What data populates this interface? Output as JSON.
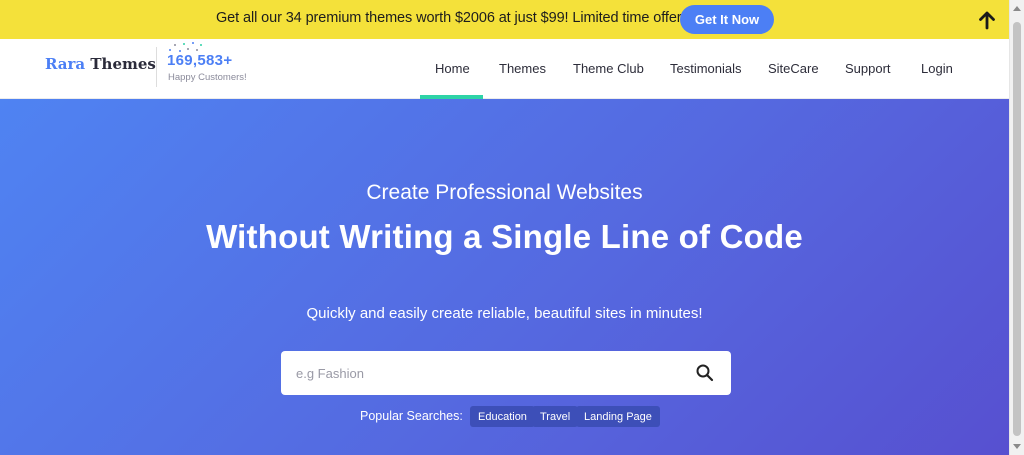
{
  "promo": {
    "text": "Get all our 34 premium themes worth $2006 at just $99! Limited time offer.",
    "button_label": "Get It Now",
    "colors": {
      "background": "#f4e13a",
      "button": "#4c7ff5"
    }
  },
  "header": {
    "logo_part1": "Rara",
    "logo_part2": "Themes",
    "customer_count": "169,583+",
    "customer_label": "Happy Customers!",
    "nav": [
      {
        "label": "Home",
        "active": true
      },
      {
        "label": "Themes"
      },
      {
        "label": "Theme Club"
      },
      {
        "label": "Testimonials"
      },
      {
        "label": "SiteCare"
      },
      {
        "label": "Support"
      },
      {
        "label": "Login"
      }
    ],
    "colors": {
      "accent": "#4c7ff5",
      "active_underline": "#2ed3a7"
    }
  },
  "hero": {
    "subtitle": "Create Professional Websites",
    "title": "Without Writing a Single Line of Code",
    "description": "Quickly and easily create reliable, beautiful sites in minutes!",
    "search_placeholder": "e.g Fashion",
    "popular_label": "Popular Searches:",
    "popular_tags": [
      "Education",
      "Travel",
      "Landing Page"
    ],
    "colors": {
      "gradient_start": "#4f83f2",
      "gradient_end": "#5750d0",
      "tag": "#3d4fb8"
    }
  },
  "icons": {
    "scroll_top": "arrow-up-icon",
    "search": "search-icon"
  }
}
